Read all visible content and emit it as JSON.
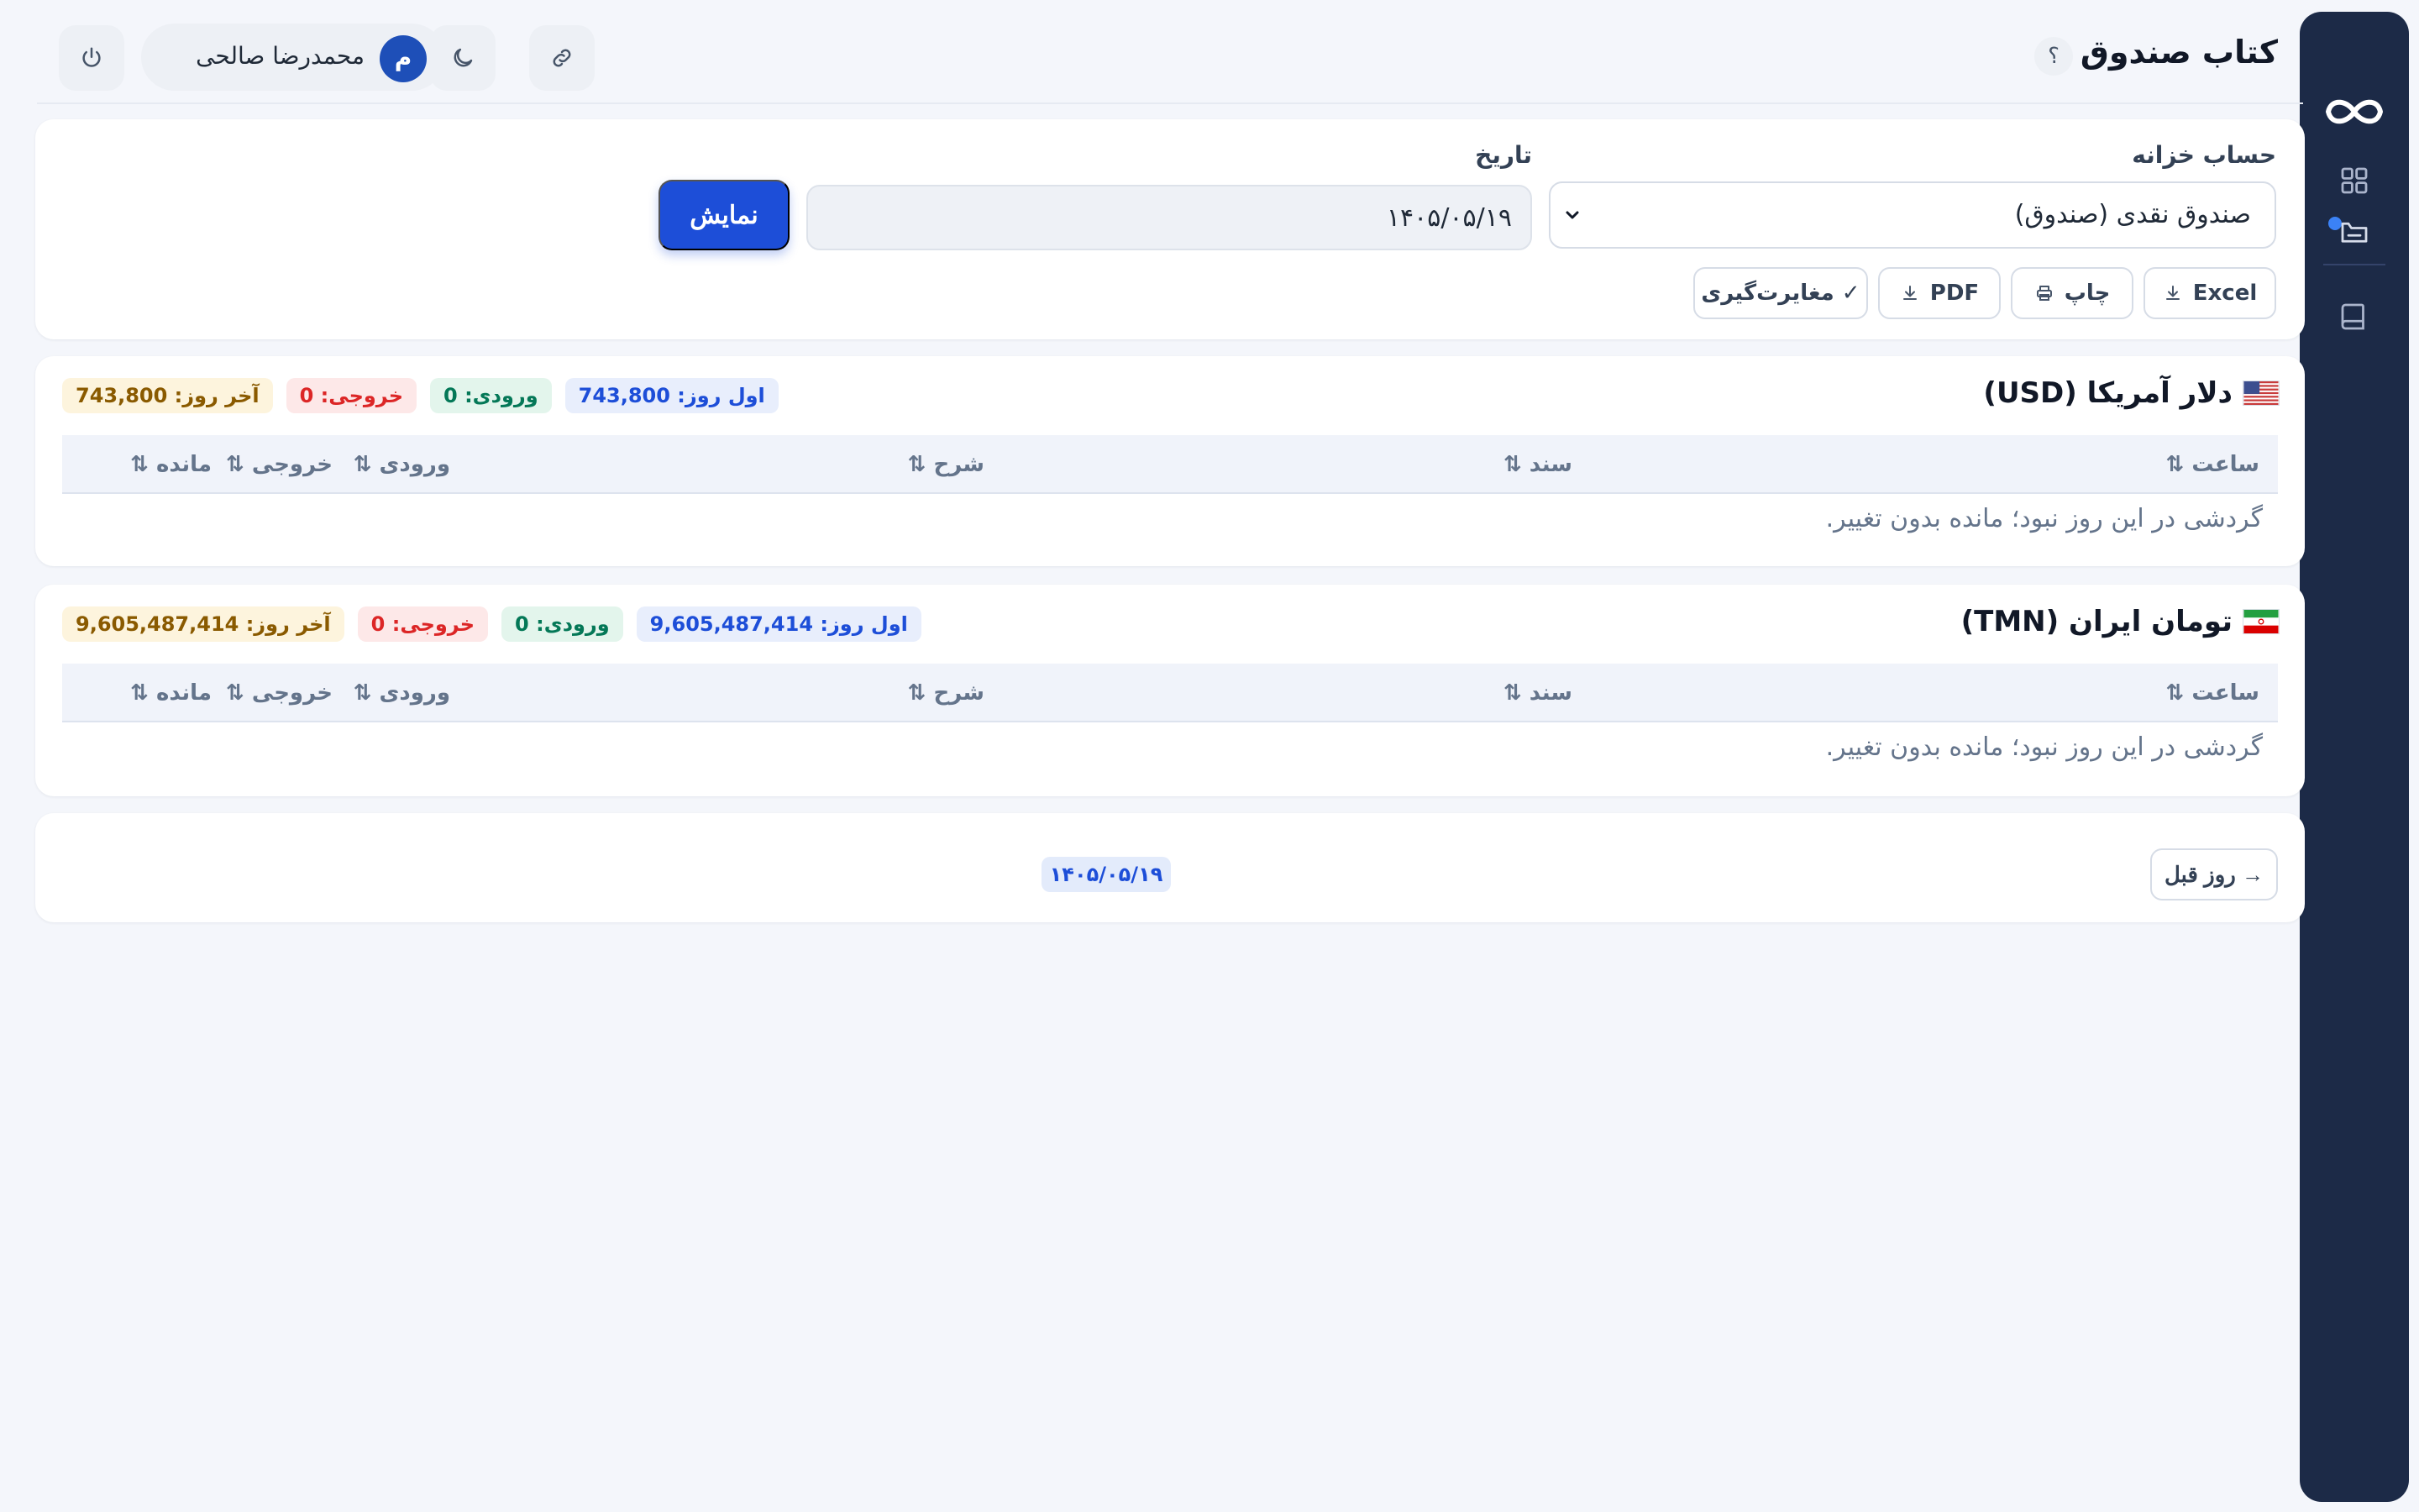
{
  "header": {
    "title": "کتاب صندوق",
    "help_label": "؟",
    "user": {
      "initial": "م",
      "name": "محمدرضا صالحی"
    }
  },
  "sidebar": {
    "items": [
      {
        "icon": "infinity-logo-icon"
      },
      {
        "icon": "dashboard-grid-icon"
      },
      {
        "icon": "cash-book-icon",
        "active": true
      },
      {
        "icon": "book-icon"
      }
    ]
  },
  "filters": {
    "account_label": "حساب خزانه",
    "account_value": "صندوق نقدی (صندوق)",
    "date_label": "تاریخ",
    "date_value": "۱۴۰۵/۰۵/۱۹",
    "show_button": "نمایش",
    "tools": {
      "excel": "Excel",
      "print": "چاپ",
      "pdf": "PDF",
      "reconcile": "✓ مغایرت‌گیری"
    }
  },
  "table_headers": {
    "time": "ساعت ⇅",
    "doc": "سند ⇅",
    "desc": "شرح ⇅",
    "in": "ورودی ⇅",
    "out": "خروجی ⇅",
    "balance": "مانده ⇅"
  },
  "sections": {
    "usd": {
      "title": "دلار آمریکا (USD)",
      "opening": "اول روز: 743,800",
      "incoming": "ورودی: 0",
      "outgoing": "خروجی: 0",
      "closing": "آخر روز: 743,800",
      "empty_message": "گردشی در این روز نبود؛ مانده بدون تغییر."
    },
    "tmn": {
      "title": "تومان ایران (TMN)",
      "opening": "اول روز: 9,605,487,414",
      "incoming": "ورودی: 0",
      "outgoing": "خروجی: 0",
      "closing": "آخر روز: 9,605,487,414",
      "empty_message": "گردشی در این روز نبود؛ مانده بدون تغییر."
    }
  },
  "navigation": {
    "prev_day": "→ روز قبل",
    "current_date": "۱۴۰۵/۰۵/۱۹"
  },
  "colors": {
    "sidebar_bg": "#1c2a47",
    "primary": "#1d4ed8",
    "page_bg": "#f4f6fb"
  }
}
